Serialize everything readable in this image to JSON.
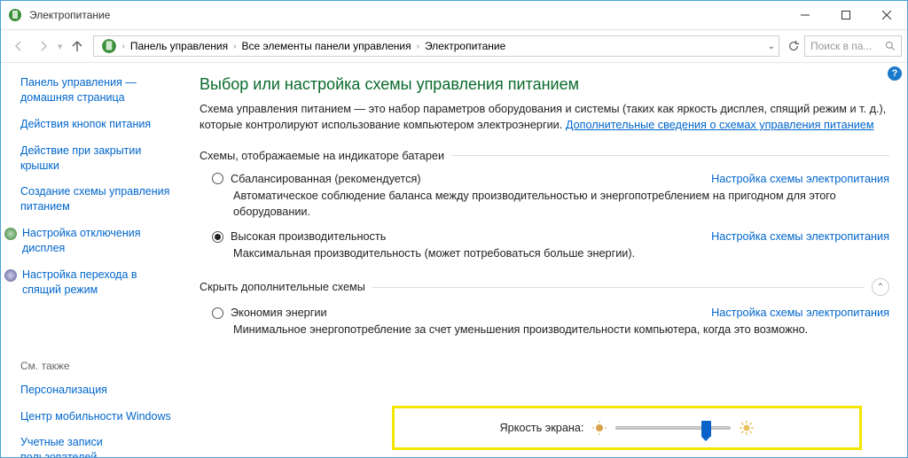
{
  "window": {
    "title": "Электропитание"
  },
  "toolbar": {
    "breadcrumb": [
      "Панель управления",
      "Все элементы панели управления",
      "Электропитание"
    ],
    "search_placeholder": "Поиск в па..."
  },
  "sidebar": {
    "home": "Панель управления — домашняя страница",
    "links": [
      "Действия кнопок питания",
      "Действие при закрытии крышки",
      "Создание схемы управления питанием"
    ],
    "iconlinks": [
      "Настройка отключения дисплея",
      "Настройка перехода в спящий режим"
    ],
    "seealso_hdr": "См. также",
    "seealso": [
      "Персонализация",
      "Центр мобильности Windows",
      "Учетные записи пользователей"
    ]
  },
  "main": {
    "title": "Выбор или настройка схемы управления питанием",
    "desc": "Схема управления питанием — это набор параметров оборудования и системы (таких как яркость дисплея, спящий режим и т. д.), которые контролируют использование компьютером электроэнергии.",
    "desc_link": "Дополнительные сведения о схемах управления питанием",
    "section1": "Схемы, отображаемые на индикаторе батареи",
    "section2": "Скрыть дополнительные схемы",
    "plan_link": "Настройка схемы электропитания",
    "plans": [
      {
        "name": "Сбалансированная (рекомендуется)",
        "checked": false,
        "desc": "Автоматическое соблюдение баланса между производительностью и энергопотреблением на пригодном для этого оборудовании."
      },
      {
        "name": "Высокая производительность",
        "checked": true,
        "desc": "Максимальная производительность (может потребоваться больше энергии)."
      }
    ],
    "plans2": [
      {
        "name": "Экономия энергии",
        "checked": false,
        "desc": "Минимальное энергопотребление за счет уменьшения производительности компьютера, когда это возможно."
      }
    ],
    "brightness_label": "Яркость экрана:"
  }
}
